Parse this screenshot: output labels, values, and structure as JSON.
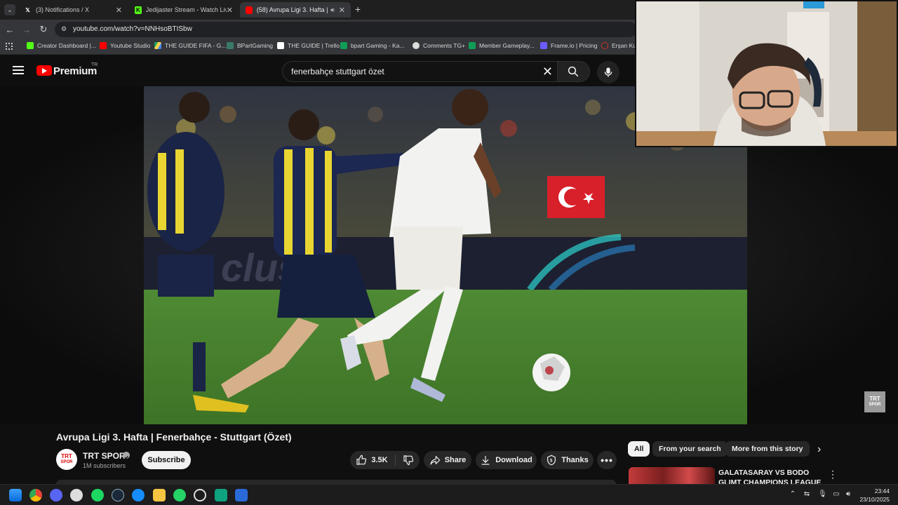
{
  "browser": {
    "tabs": [
      {
        "title": "(3) Notifications / X",
        "icon": "x-logo-icon"
      },
      {
        "title": "Jedijaster Stream - Watch Live o",
        "icon": "kick-logo-icon"
      },
      {
        "title": "(58) Avrupa Ligi 3. Hafta | Fe",
        "icon": "youtube-logo-icon",
        "active": true
      }
    ],
    "url": "youtube.com/watch?v=NNHsoBTISbw",
    "bookmarks": [
      "Creator Dashboard |...",
      "Youtube Studio",
      "THE GUIDE FIFA - G...",
      "BPartGaming",
      "THE GUIDE | Trello",
      "bpart Gaming - Ka...",
      "Comments TG+",
      "Member Gameplay...",
      "Frame.io | Pricing",
      "Erşan Ku"
    ]
  },
  "header": {
    "brand": "Premium",
    "region": "TR",
    "search_query": "fenerbahçe stuttgart özet"
  },
  "video": {
    "title": "Avrupa Ligi 3. Hafta | Fenerbahçe - Stuttgart (Özet)",
    "watermark_line1": "TRT",
    "watermark_line2": "SPOR"
  },
  "channel": {
    "name": "TRT SPOR",
    "subscribers": "1M subscribers",
    "subscribe_label": "Subscribe",
    "avatar_line1": "TRT",
    "avatar_line2": "SPOR"
  },
  "actions": {
    "likes": "3.5K",
    "share": "Share",
    "download": "Download",
    "thanks": "Thanks"
  },
  "chips": [
    "All",
    "From your search",
    "More from this story"
  ],
  "recommendation": {
    "title": "GALATASARAY VS BODO GLIMT CHAMPIONS LEAGUE"
  },
  "taskbar": {
    "time": "23:44",
    "date": "23/10/2025"
  },
  "colors": {
    "youtube_red": "#ff0000",
    "background": "#0f0f0f",
    "pill": "#272727"
  }
}
